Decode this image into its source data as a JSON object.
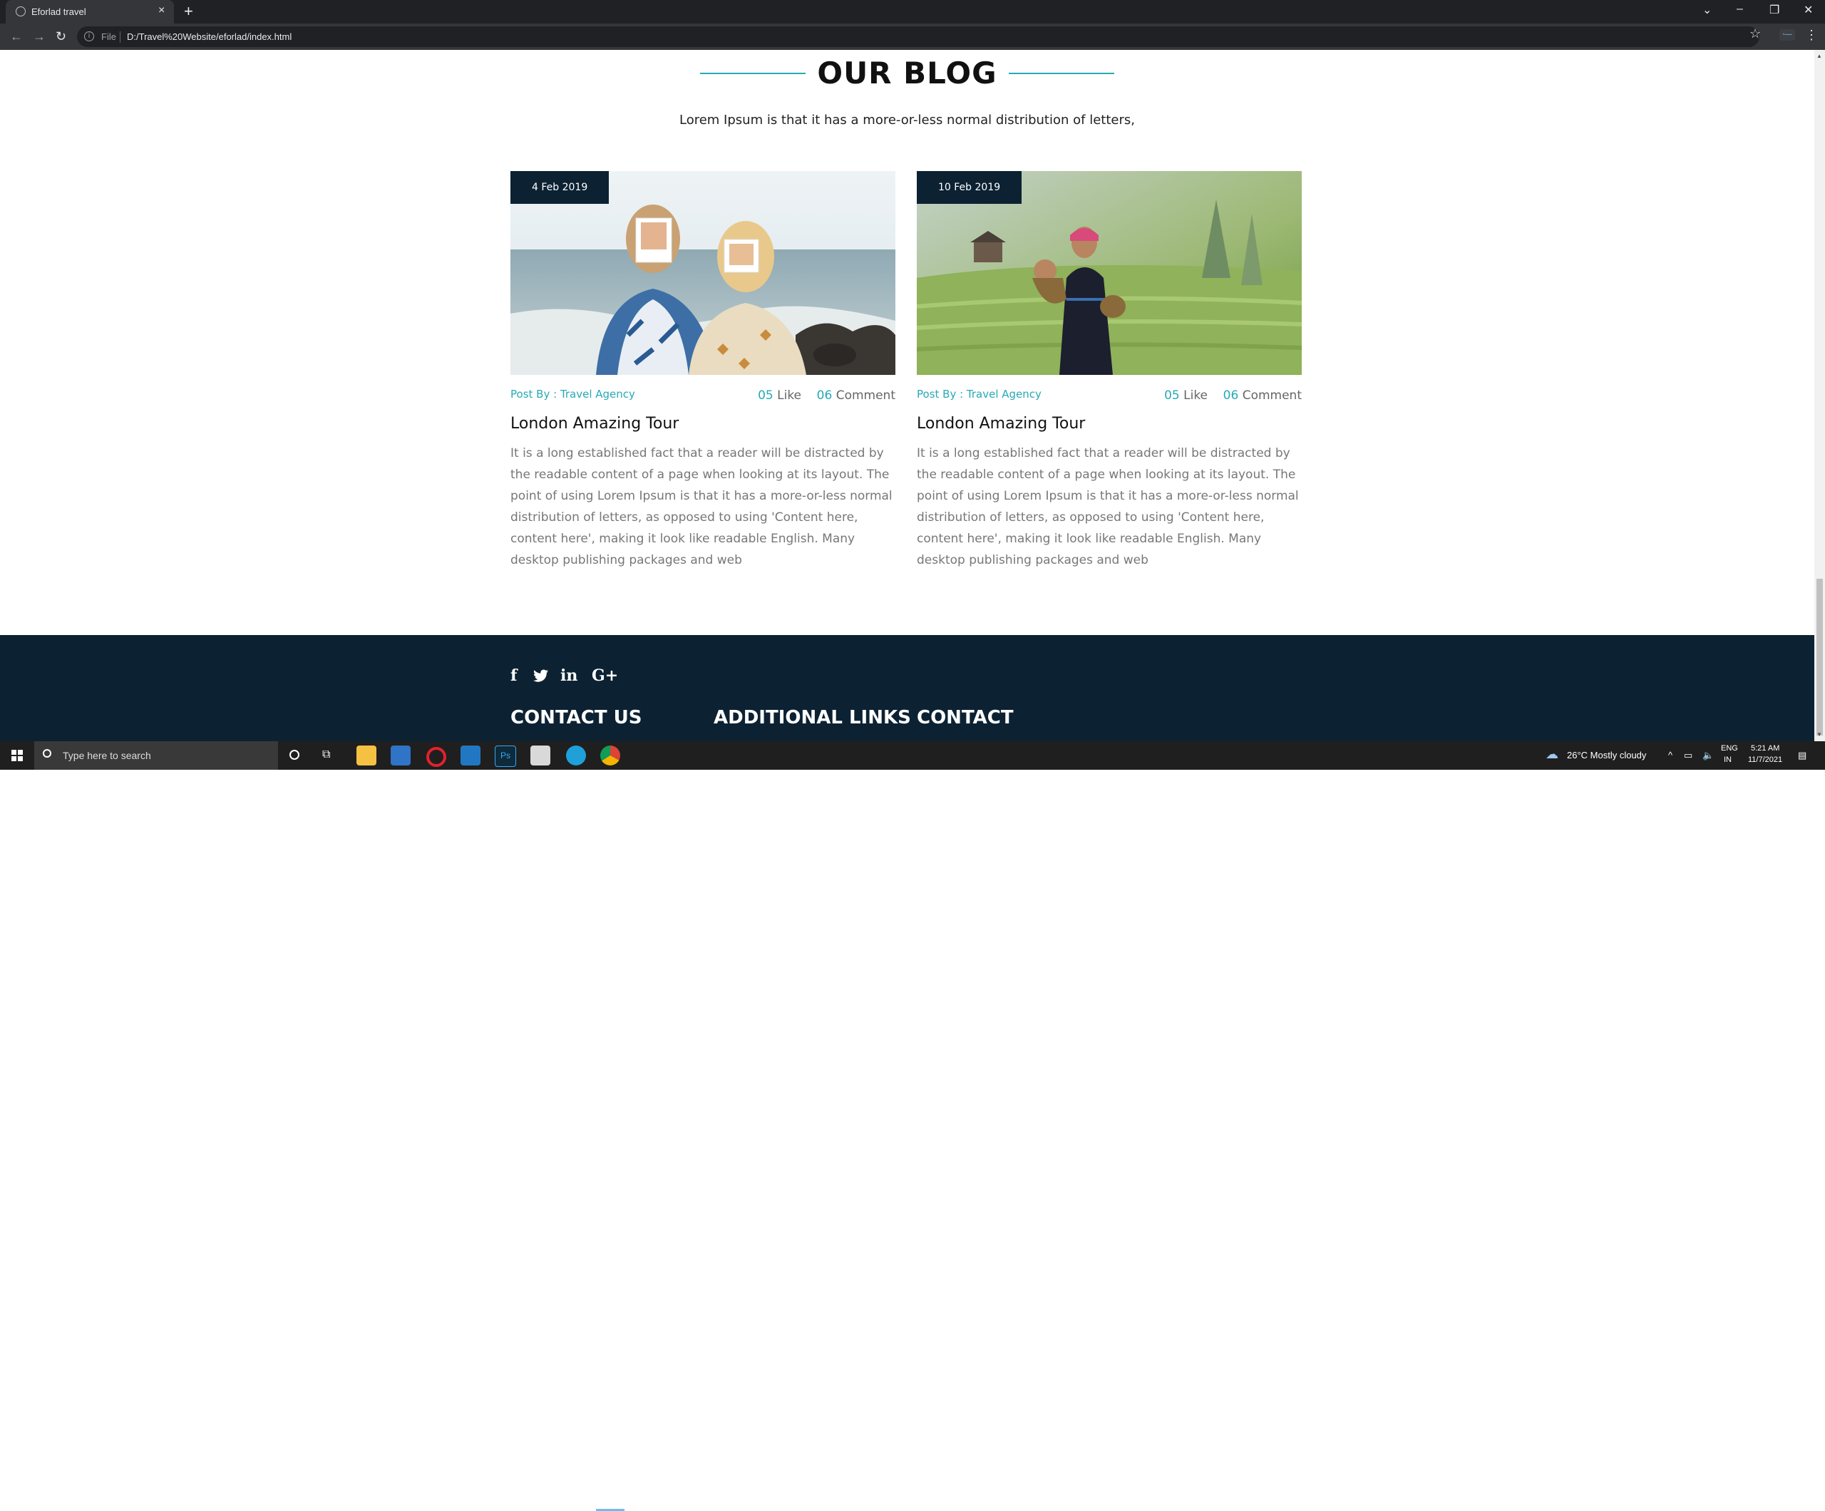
{
  "browser": {
    "tab_title": "Eforlad travel",
    "address_prefix": "File",
    "url": "D:/Travel%20Website/eforlad/index.html"
  },
  "blog": {
    "title": "OUR BLOG",
    "subtitle": "Lorem Ipsum is that it has a more-or-less normal distribution of letters,",
    "posts": [
      {
        "date": "4 Feb 2019",
        "post_by": "Post By : Travel Agency",
        "likes": "05",
        "likes_label": "Like",
        "comments": "06",
        "comments_label": "Comment",
        "title": "London Amazing Tour",
        "text": "It is a long established fact that a reader will be distracted by the readable content of a page when looking at its layout. The point of using Lorem Ipsum is that it has a more-or-less normal distribution of letters, as opposed to using 'Content here, content here', making it look like readable English. Many desktop publishing packages and web"
      },
      {
        "date": "10 Feb 2019",
        "post_by": "Post By : Travel Agency",
        "likes": "05",
        "likes_label": "Like",
        "comments": "06",
        "comments_label": "Comment",
        "title": "London Amazing Tour",
        "text": "It is a long established fact that a reader will be distracted by the readable content of a page when looking at its layout. The point of using Lorem Ipsum is that it has a more-or-less normal distribution of letters, as opposed to using 'Content here, content here', making it look like readable English. Many desktop publishing packages and web"
      }
    ]
  },
  "footer": {
    "social_icons": [
      "facebook-icon",
      "twitter-icon",
      "linkedin-icon",
      "google-plus-icon"
    ],
    "columns": [
      "CONTACT US",
      "ADDITIONAL LINKS",
      "CONTACT"
    ]
  },
  "taskbar": {
    "search_placeholder": "Type here to search",
    "weather": "26°C  Mostly cloudy",
    "language": "ENG",
    "region": "IN",
    "time": "5:21 AM",
    "date": "11/7/2021"
  },
  "colors": {
    "accent": "#28a9b5",
    "navy": "#0c2233"
  }
}
